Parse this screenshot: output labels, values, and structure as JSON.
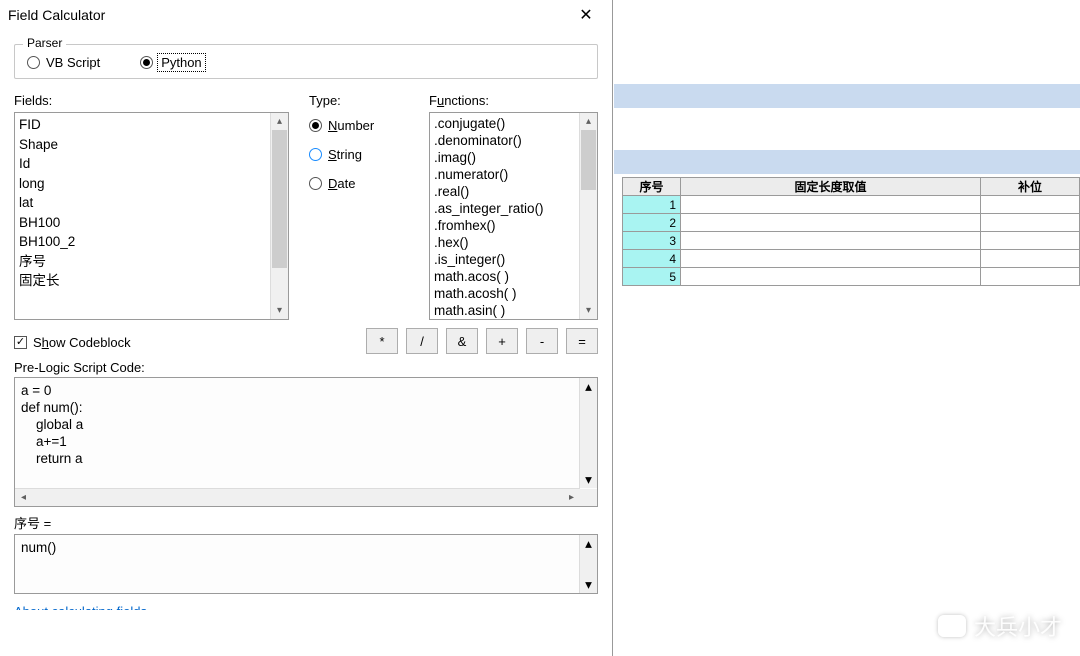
{
  "dialog": {
    "title": "Field Calculator",
    "parser_legend": "Parser",
    "parser": {
      "vbscript_label": "VB Script",
      "python_label": "Python",
      "selected": "python"
    },
    "fields_label": "Fields:",
    "type_label": "Type:",
    "functions_label": "Functions:",
    "fields": [
      "FID",
      "Shape",
      "Id",
      "long",
      "lat",
      "BH100",
      "BH100_2",
      "序号",
      "固定长"
    ],
    "type_options": {
      "number_label": "Number",
      "string_label": "String",
      "date_label": "Date",
      "selected": "number"
    },
    "functions": [
      ".conjugate()",
      ".denominator()",
      ".imag()",
      ".numerator()",
      ".real()",
      ".as_integer_ratio()",
      ".fromhex()",
      ".hex()",
      ".is_integer()",
      "math.acos( )",
      "math.acosh( )",
      "math.asin( )"
    ],
    "show_codeblock_label": "Show Codeblock",
    "show_codeblock_checked": true,
    "operators": [
      "*",
      "/",
      "&",
      "+",
      "-",
      "="
    ],
    "prelogic_label": "Pre-Logic Script Code:",
    "prelogic_code": "a = 0\ndef num():\n    global a\n    a+=1\n    return a",
    "expr_label": "序号 =",
    "expr_code": "num()",
    "about_link": "About calculating fields"
  },
  "accesskeys": {
    "functions_u": "u",
    "number_u": "N",
    "string_u": "S",
    "date_u": "D",
    "codeblock_u": "h"
  },
  "table": {
    "headers": [
      "序号",
      "固定长度取值",
      "补位"
    ],
    "rows": [
      {
        "n": "1",
        "c1": "",
        "c2": ""
      },
      {
        "n": "2",
        "c1": "",
        "c2": ""
      },
      {
        "n": "3",
        "c1": "",
        "c2": ""
      },
      {
        "n": "4",
        "c1": "",
        "c2": ""
      },
      {
        "n": "5",
        "c1": "",
        "c2": ""
      }
    ]
  },
  "watermark": "大兵小才"
}
